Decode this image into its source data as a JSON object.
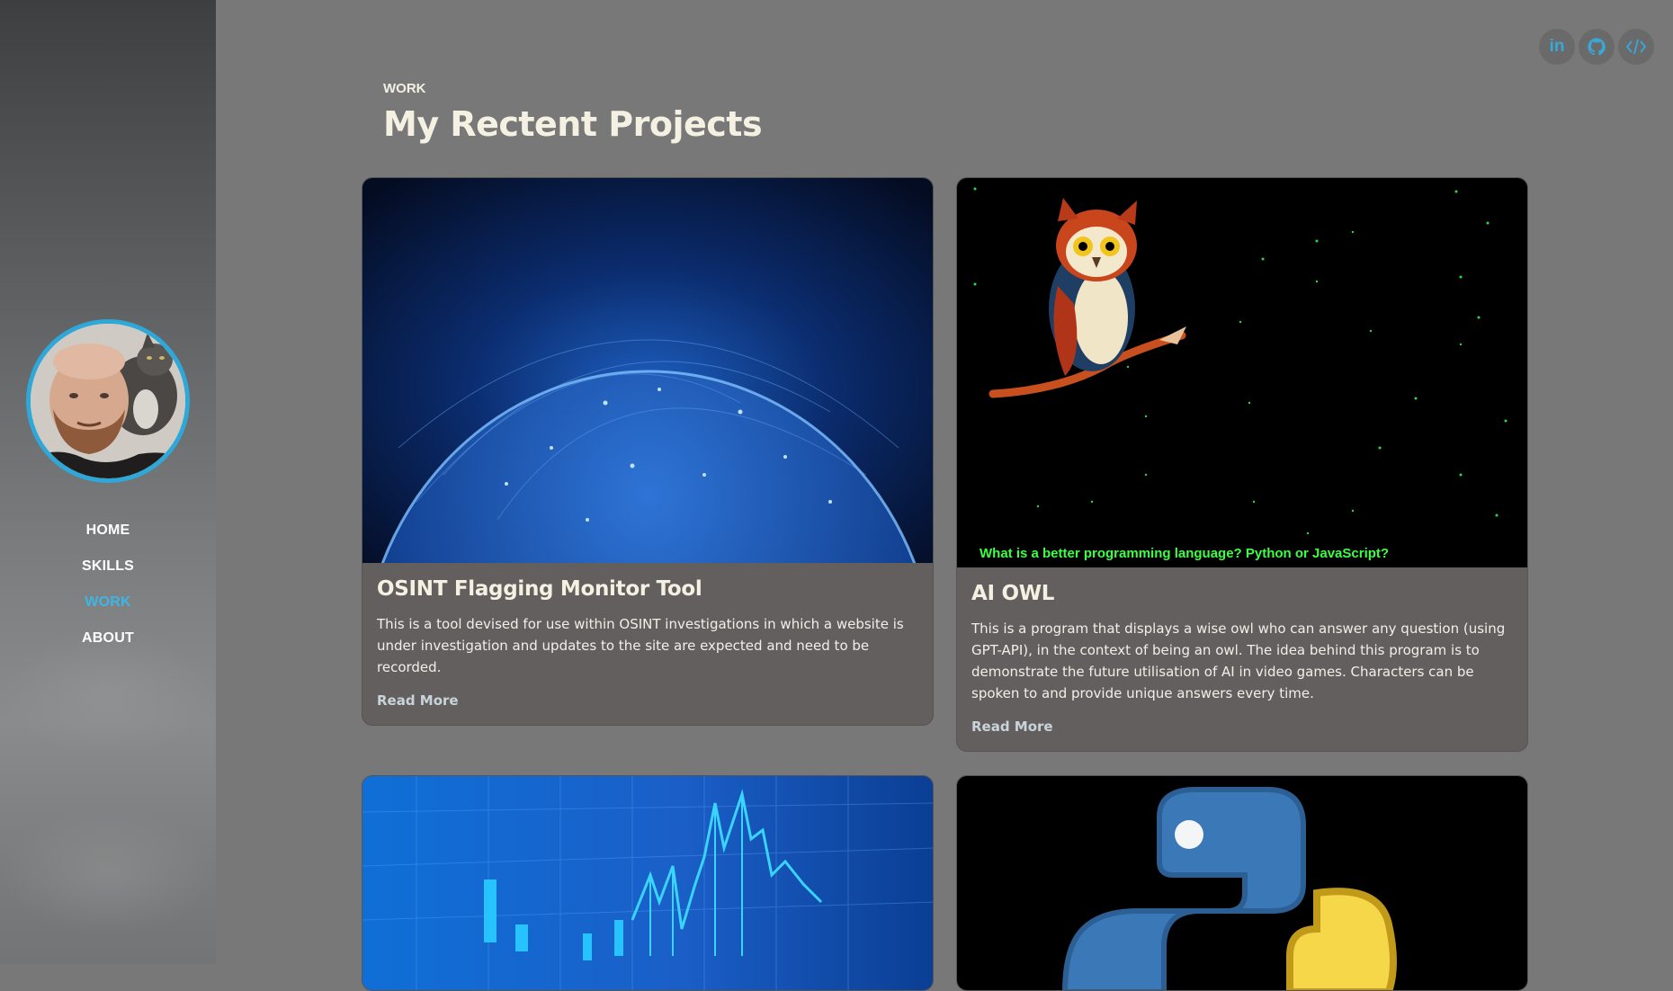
{
  "sidebar": {
    "nav": [
      {
        "label": "HOME",
        "active": false
      },
      {
        "label": "SKILLS",
        "active": false
      },
      {
        "label": "WORK",
        "active": true
      },
      {
        "label": "ABOUT",
        "active": false
      }
    ],
    "accent_color": "#3db6e6"
  },
  "social": [
    {
      "icon": "linkedin-icon",
      "glyph": "in"
    },
    {
      "icon": "github-icon"
    },
    {
      "icon": "code-icon"
    }
  ],
  "header": {
    "section_label": "WORK",
    "title": "My Rectent Projects"
  },
  "projects": [
    {
      "image": "globe-network-image",
      "title": "OSINT Flagging Monitor Tool",
      "description": "This is a tool devised for use within OSINT investigations in which a website is under investigation and updates to the site are expected and need to be recorded.",
      "link_label": "Read More"
    },
    {
      "image": "owl-image",
      "image_caption": "What is a better programming language? Python or JavaScript?",
      "title": "AI OWL",
      "description": "This is a program that displays a wise owl who can answer any question (using GPT-API), in the context of being an owl. The idea behind this program is to demonstrate the future utilisation of AI in video games. Characters can be spoken to and provide unique answers every time.",
      "link_label": "Read More"
    },
    {
      "image": "stock-chart-image"
    },
    {
      "image": "python-logo-image"
    }
  ]
}
